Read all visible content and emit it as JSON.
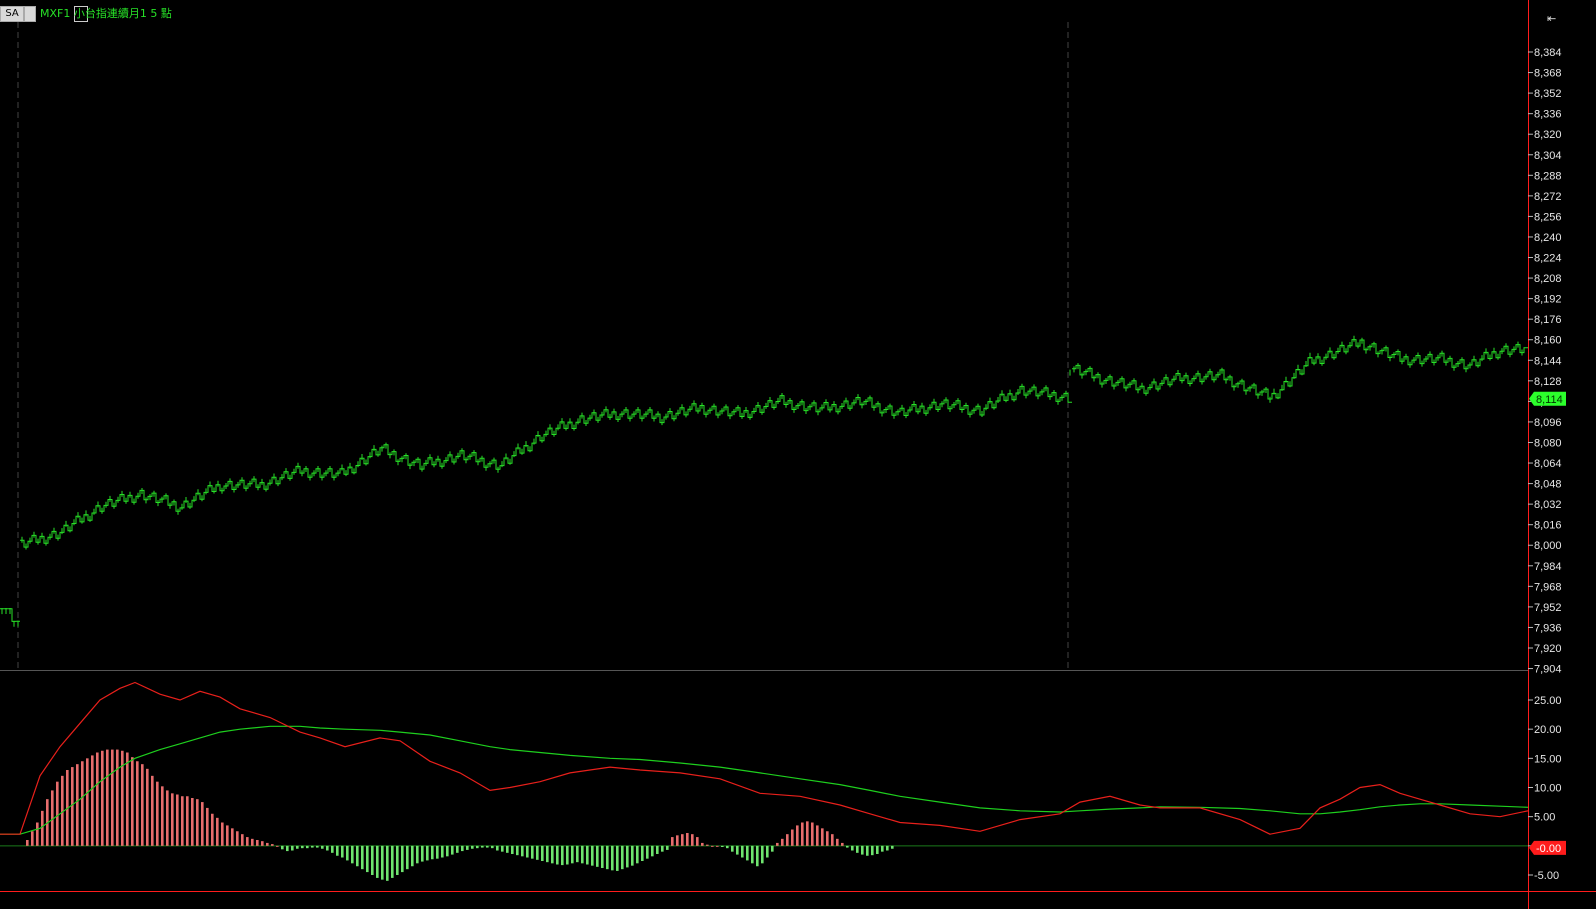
{
  "header": {
    "sa_label": "SA",
    "title": "MXF1  小台指連續月1  5 點"
  },
  "colors": {
    "price": "#27e027",
    "last_price_bg": "#2cff2c",
    "dif": "#e8201b",
    "macd": "#1ecf1e",
    "osc_pos": "#e86d6d",
    "osc_neg": "#6fe46f",
    "grid": "#2a2a2a",
    "axis_text": "#e6e6e6",
    "axis_line": "#ff1c1c"
  },
  "price_axis": {
    "ticks": [
      "8,384",
      "8,368",
      "8,352",
      "8,336",
      "8,320",
      "8,304",
      "8,288",
      "8,272",
      "8,256",
      "8,240",
      "8,224",
      "8,208",
      "8,192",
      "8,176",
      "8,160",
      "8,144",
      "8,128",
      "8,112",
      "8,096",
      "8,080",
      "8,064",
      "8,048",
      "8,032",
      "8,016",
      "8,000",
      "7,984",
      "7,968",
      "7,952",
      "7,936",
      "7,920",
      "7,904"
    ],
    "last_price_label": "8,114"
  },
  "osc_axis": {
    "ticks": [
      "25.00",
      "20.00",
      "15.00",
      "10.00",
      "5.00",
      "0.00",
      "-5.00"
    ],
    "last_value_label": "-0.00"
  },
  "chart_data": [
    {
      "type": "line",
      "name_hidden": true,
      "ylim": [
        7904,
        8392
      ],
      "x": [
        0,
        18,
        19,
        60,
        100,
        140,
        180,
        220,
        260,
        300,
        340,
        380,
        420,
        460,
        500,
        540,
        580,
        620,
        660,
        700,
        740,
        780,
        820,
        860,
        900,
        940,
        980,
        1020,
        1068,
        1070,
        1100,
        1140,
        1180,
        1220,
        1270,
        1310,
        1360,
        1400,
        1440,
        1470,
        1500,
        1528
      ],
      "values": [
        7955,
        7939,
        8000,
        8010,
        8030,
        8040,
        8030,
        8047,
        8047,
        8058,
        8055,
        8075,
        8062,
        8070,
        8062,
        8085,
        8098,
        8103,
        8100,
        8107,
        8102,
        8112,
        8106,
        8112,
        8103,
        8110,
        8105,
        8121,
        8115,
        8138,
        8130,
        8122,
        8130,
        8132,
        8115,
        8143,
        8158,
        8145,
        8145,
        8140,
        8152,
        8153
      ]
    },
    {
      "type": "line",
      "ylim": [
        -7.5,
        30
      ],
      "x": [
        0,
        20,
        40,
        60,
        80,
        100,
        120,
        135,
        160,
        180,
        200,
        220,
        240,
        270,
        300,
        320,
        345,
        380,
        400,
        430,
        460,
        490,
        510,
        540,
        570,
        610,
        640,
        680,
        720,
        760,
        800,
        840,
        870,
        900,
        940,
        980,
        1020,
        1060,
        1080,
        1110,
        1140,
        1160,
        1200,
        1240,
        1270,
        1300,
        1320,
        1340,
        1360,
        1380,
        1400,
        1420,
        1440,
        1470,
        1500,
        1528
      ],
      "dif": [
        2.0,
        2.0,
        12.0,
        17.0,
        21.0,
        25.0,
        27.0,
        28.0,
        26.0,
        25.0,
        26.5,
        25.5,
        23.5,
        22.0,
        19.5,
        18.5,
        17.0,
        18.5,
        18.0,
        14.5,
        12.5,
        9.5,
        10.0,
        11.0,
        12.5,
        13.5,
        13.0,
        12.5,
        11.5,
        9.0,
        8.5,
        7.0,
        5.5,
        4.0,
        3.5,
        2.5,
        4.5,
        5.5,
        7.5,
        8.5,
        7.0,
        6.5,
        6.5,
        4.5,
        2.0,
        3.0,
        6.5,
        8.0,
        10.0,
        10.5,
        9.0,
        8.0,
        7.0,
        5.5,
        5.0,
        6.0
      ],
      "macd": [
        2.0,
        2.0,
        3.0,
        5.5,
        8.0,
        11.0,
        13.5,
        15.0,
        16.5,
        17.5,
        18.5,
        19.5,
        20.0,
        20.5,
        20.5,
        20.2,
        20.0,
        19.8,
        19.5,
        19.0,
        18.0,
        17.0,
        16.5,
        16.0,
        15.5,
        15.0,
        14.8,
        14.2,
        13.5,
        12.5,
        11.5,
        10.5,
        9.5,
        8.5,
        7.5,
        6.5,
        6.0,
        5.8,
        6.0,
        6.3,
        6.5,
        6.7,
        6.6,
        6.4,
        6.0,
        5.5,
        5.5,
        5.8,
        6.2,
        6.7,
        7.0,
        7.2,
        7.2,
        7.0,
        6.8,
        6.6
      ]
    },
    {
      "type": "bar",
      "ylim": [
        -7.5,
        30
      ],
      "x_start": 26,
      "x_step": 5.0,
      "values": [
        1.0,
        2.5,
        4.0,
        6.0,
        8.0,
        9.5,
        11.0,
        12.0,
        13.0,
        13.5,
        14.0,
        14.5,
        15.0,
        15.5,
        16.0,
        16.3,
        16.5,
        16.5,
        16.5,
        16.3,
        16.0,
        15.2,
        14.5,
        14.0,
        13.2,
        12.0,
        11.0,
        10.2,
        9.5,
        9.0,
        8.8,
        8.5,
        8.5,
        8.2,
        8.0,
        7.5,
        6.5,
        5.5,
        4.8,
        4.0,
        3.5,
        3.0,
        2.5,
        2.0,
        1.5,
        1.2,
        1.0,
        0.8,
        0.5,
        0.3,
        0.0,
        -0.6,
        -0.9,
        -0.8,
        -0.5,
        -0.4,
        -0.4,
        -0.3,
        -0.3,
        -0.5,
        -0.8,
        -1.2,
        -1.7,
        -2.0,
        -2.5,
        -3.0,
        -3.5,
        -4.0,
        -4.5,
        -5.0,
        -5.5,
        -5.8,
        -6.0,
        -5.5,
        -5.0,
        -4.5,
        -4.0,
        -3.5,
        -3.0,
        -2.7,
        -2.5,
        -2.3,
        -2.2,
        -2.0,
        -1.8,
        -1.5,
        -1.2,
        -0.9,
        -0.7,
        -0.5,
        -0.4,
        -0.3,
        -0.3,
        -0.4,
        -0.8,
        -1.0,
        -1.2,
        -1.4,
        -1.6,
        -1.8,
        -2.0,
        -2.2,
        -2.4,
        -2.6,
        -2.8,
        -3.0,
        -3.2,
        -3.3,
        -3.2,
        -3.0,
        -2.8,
        -3.0,
        -3.2,
        -3.4,
        -3.6,
        -3.8,
        -4.0,
        -4.2,
        -4.3,
        -4.0,
        -3.7,
        -3.4,
        -3.0,
        -2.6,
        -2.2,
        -1.8,
        -1.4,
        -1.0,
        -0.7,
        1.5,
        1.8,
        2.0,
        2.2,
        2.0,
        1.5,
        0.5,
        0.2,
        0.0,
        0.0,
        -0.2,
        -0.4,
        -1.0,
        -1.5,
        -2.0,
        -2.5,
        -3.0,
        -3.5,
        -3.0,
        -2.0,
        -1.0,
        0.5,
        1.2,
        2.0,
        2.8,
        3.5,
        4.0,
        4.2,
        4.0,
        3.5,
        3.0,
        2.5,
        2.0,
        1.2,
        0.5,
        -0.3,
        -0.8,
        -1.2,
        -1.5,
        -1.7,
        -1.6,
        -1.4,
        -1.0,
        -0.8,
        -0.5
      ]
    }
  ]
}
